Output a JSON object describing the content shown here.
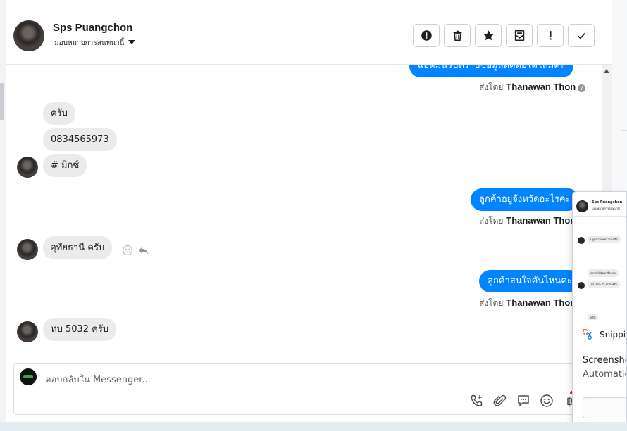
{
  "header": {
    "name": "Sps Puangchon",
    "assign_label": "มอบหมายการสนทนานี้",
    "toolbar": [
      {
        "icon": "alert-circle-icon"
      },
      {
        "icon": "trash-icon"
      },
      {
        "icon": "star-icon"
      },
      {
        "icon": "archive-mail-icon"
      },
      {
        "icon": "exclamation-icon"
      },
      {
        "icon": "checkmark-icon"
      }
    ]
  },
  "messages": {
    "top_partial": "แอดมินรับทราบข้อมูลติดต่อได้ใหม่คะ",
    "sent_by_prefix": "ส่งโดย",
    "agent_name": "Thanawan Thon",
    "m1": "ครับ",
    "m2": "0834565973",
    "m3": "# มิกซ์",
    "m4": "ลูกค้าอยู่จังหวัดอะไรคะ",
    "m5": "อุทัยธานี ครับ",
    "m6": "ลูกค้าสนใจคันไหนคะ",
    "m7": "ทบ 5032 ครับ"
  },
  "composer": {
    "placeholder": "ตอบกลับใน Messenger...",
    "baht_symbol": "฿"
  },
  "snip_popup": {
    "thumb_name": "Sps Puangchon",
    "thumb_sub": "มอบหมายการสนทนานี้",
    "thumb_b1": "ปลูกป่าไทลพาวานหรือ",
    "thumb_b2": "อยากได้คิดหารือสอบ",
    "thumb_b3": "20,000-25,000 ครับ",
    "thumb_b4": "ครับ",
    "app_name": "Snipping Tool",
    "title": "Screenshot copied",
    "desc": "Automatically saved"
  },
  "colors": {
    "accent": "#0084ff",
    "bubble_in": "#ebebeb"
  }
}
